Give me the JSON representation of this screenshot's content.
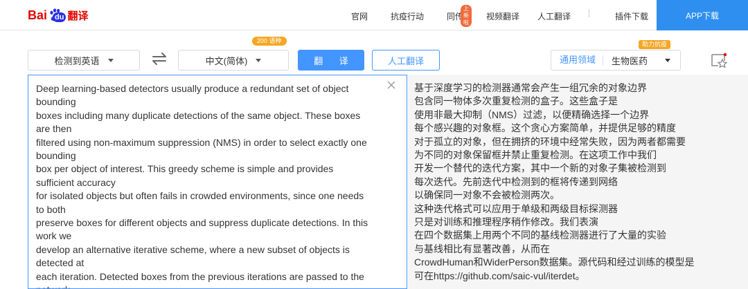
{
  "logo": {
    "bai": "Bai",
    "du": "du",
    "fanyi": "翻译"
  },
  "nav": {
    "items": [
      "官网",
      "抗疫行动",
      "同传",
      "视频翻译",
      "人工翻译",
      "插件下载"
    ],
    "new_badge": "上新啦",
    "app_download": "APP下载"
  },
  "toolbar": {
    "source_lang": "检测到英语",
    "target_lang": "中文(简体)",
    "lang_count_badge": "200 语种",
    "translate_button": "翻 译",
    "human_translate_button": "人工翻译",
    "domain_label": "通用领域",
    "domain_value": "生物医药",
    "help_badge": "助力抗疫"
  },
  "source": {
    "text": "Deep learning-based detectors usually produce a redundant set of object\nbounding\nboxes including many duplicate detections of the same object. These boxes\nare then\nfiltered using non-maximum suppression (NMS) in order to select exactly one\nbounding\nbox per object of interest. This greedy scheme is simple and provides\nsufficient accuracy\nfor isolated objects but often fails in crowded environments, since one needs\nto both\npreserve boxes for different objects and suppress duplicate detections. In this\nwork we\ndevelop an alternative iterative scheme, where a new subset of objects is\ndetected at\neach iteration. Detected boxes from the previous iterations are passed to the\nnetwork"
  },
  "target": {
    "text": "基于深度学习的检测器通常会产生一组冗余的对象边界\n包含同一物体多次重复检测的盒子。这些盒子是\n使用非最大抑制（NMS）过滤，以便精确选择一个边界\n每个感兴趣的对象框。这个贪心方案简单，并提供足够的精度\n对于孤立的对象，但在拥挤的环境中经常失败，因为两者都需要\n为不同的对象保留框并禁止重复检测。在这项工作中我们\n开发一个替代的迭代方案，其中一个新的对象子集被检测到\n每次迭代。先前迭代中检测到的框将传递到网络\n以确保同一对象不会被检测两次。\n这种迭代格式可以应用于单级和两级目标探测器\n只是对训练和推理程序稍作修改。我们表演\n在四个数据集上用两个不同的基线检测器进行了大量的实验\n与基线相比有显著改善，从而在\nCrowdHuman和WiderPerson数据集。源代码和经过训练的模型是\n可在https://github.com/saic-vul/iterdet。"
  },
  "colors": {
    "accent": "#4395ff",
    "brand_red": "#e10601",
    "app_button": "#2f8ff0",
    "badge_orange": "#f5a623"
  }
}
